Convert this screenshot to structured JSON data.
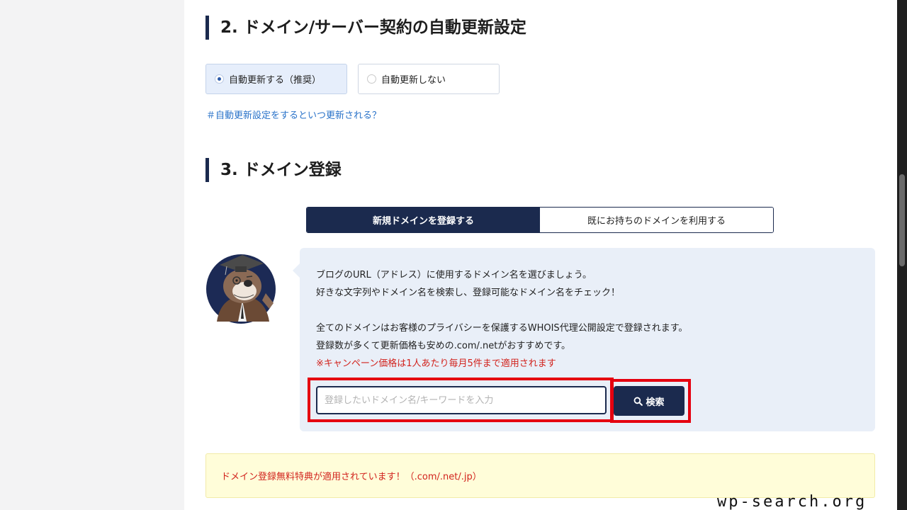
{
  "sections": {
    "auto_renew": {
      "title": "2. ドメイン/サーバー契約の自動更新設定",
      "options": [
        {
          "label": "自動更新する（推奨）",
          "selected": true
        },
        {
          "label": "自動更新しない",
          "selected": false
        }
      ],
      "help_link": "＃自動更新設定をするといつ更新される？"
    },
    "domain_register": {
      "title": "3. ドメイン登録",
      "tabs": [
        {
          "label": "新規ドメインを登録する",
          "active": true
        },
        {
          "label": "既にお持ちのドメインを利用する",
          "active": false
        }
      ],
      "info_lines": [
        "ブログのURL（アドレス）に使用するドメイン名を選びましょう。",
        "好きな文字列やドメイン名を検索し、登録可能なドメイン名をチェック！",
        "全てのドメインはお客様のプライバシーを保護するWHOIS代理公開設定で登録されます。",
        "登録数が多くて更新価格も安めの.com/.netがおすすめです。"
      ],
      "campaign_note": "※キャンペーン価格は1人あたり毎月5件まで適用されます",
      "search": {
        "value": "",
        "placeholder": "登録したいドメイン名/キーワードを入力",
        "button_label": "検索",
        "button_icon": "search-icon"
      },
      "notice": "ドメイン登録無料特典が適用されています！（.com/.net/.jp）"
    }
  },
  "watermark": "wp-search.org",
  "colors": {
    "accent_navy": "#1b2a4e",
    "link_blue": "#2a73c9",
    "alert_red": "#d2231d",
    "highlight_red": "#e5000f",
    "info_bg": "#e9eff8",
    "notice_bg": "#fffdd9"
  }
}
